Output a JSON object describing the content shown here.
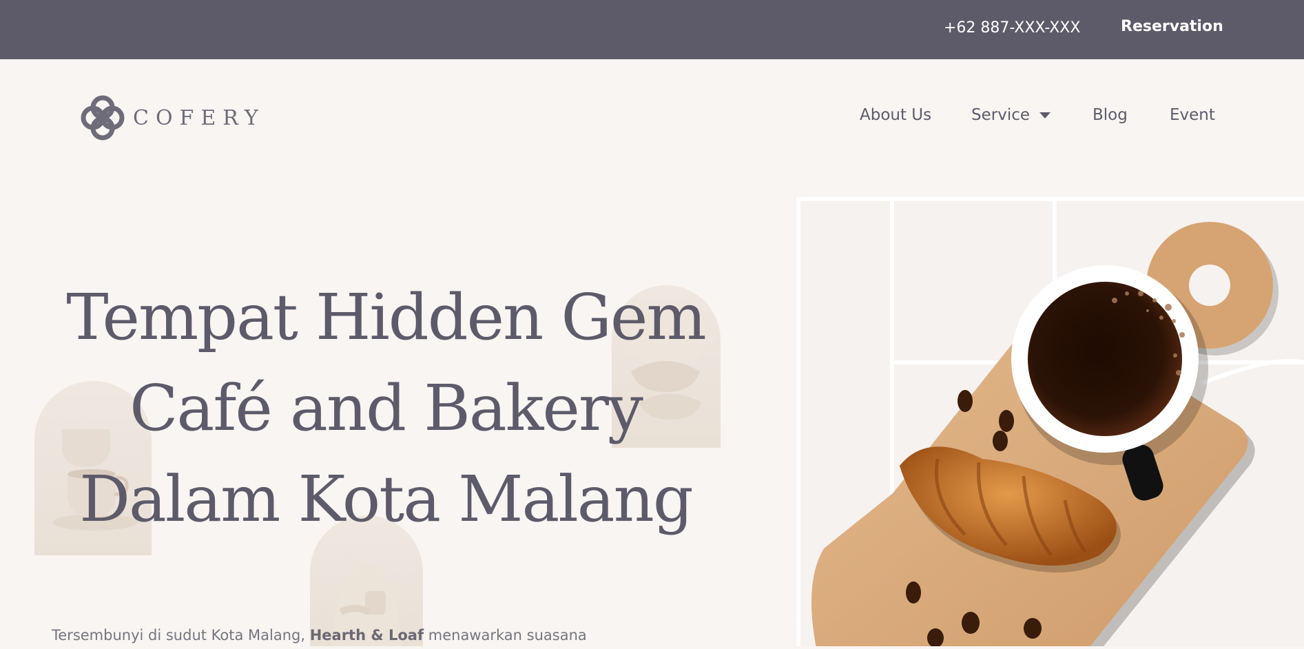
{
  "topbar": {
    "phone": "+62 887-XXX-XXX",
    "reservation_label": "Reservation"
  },
  "logo": {
    "brand": "COFERY",
    "icon": "interlocked-rings-icon"
  },
  "nav": {
    "items": [
      {
        "label": "About Us"
      },
      {
        "label": "Service",
        "has_dropdown": true
      },
      {
        "label": "Blog"
      },
      {
        "label": "Event"
      }
    ]
  },
  "hero": {
    "title_lines": [
      "Tempat Hidden Gem",
      "Café and Bakery",
      "Dalam Kota Malang"
    ],
    "intro_before": "Tersembunyi di sudut Kota Malang,",
    "intro_brand": "Hearth & Loaf",
    "intro_after": "menawarkan suasana",
    "image": "coffee-cup-and-croissant-on-wooden-board"
  },
  "colors": {
    "topbar_bg": "#5d5b6a",
    "page_bg": "#f8f5f2",
    "text_primary": "#5d5b6a",
    "wood": "#d9a777",
    "croissant": "#c77325"
  }
}
